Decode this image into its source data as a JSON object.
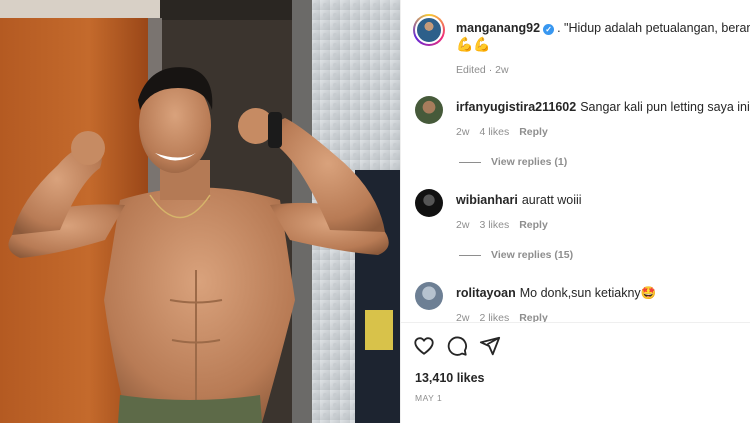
{
  "post": {
    "owner": {
      "username": "manganang92",
      "verified_icon": "verified-badge-icon",
      "caption_separator": ".",
      "caption": "\"Hidup adalah petualangan, beranikan",
      "caption_emoji": "💪💪",
      "edited_label": "Edited · 2w"
    },
    "comments": [
      {
        "username": "irfanyugistira211602",
        "text": "Sangar kali pun letting saya ini😎😎",
        "time": "2w",
        "likes": "4 likes",
        "reply_label": "Reply",
        "view_replies": "View replies (1)"
      },
      {
        "username": "wibianhari",
        "text": "auratt woiii",
        "time": "2w",
        "likes": "3 likes",
        "reply_label": "Reply",
        "view_replies": "View replies (15)"
      },
      {
        "username": "rolitayoan",
        "text": "Mo donk,sun ketiakny🤩",
        "time": "2w",
        "likes": "2 likes",
        "reply_label": "Reply"
      }
    ],
    "actions": {
      "like_icon": "heart-icon",
      "comment_icon": "comment-bubble-icon",
      "share_icon": "send-icon"
    },
    "likes_count": "13,410 likes",
    "date": "MAY 1"
  }
}
